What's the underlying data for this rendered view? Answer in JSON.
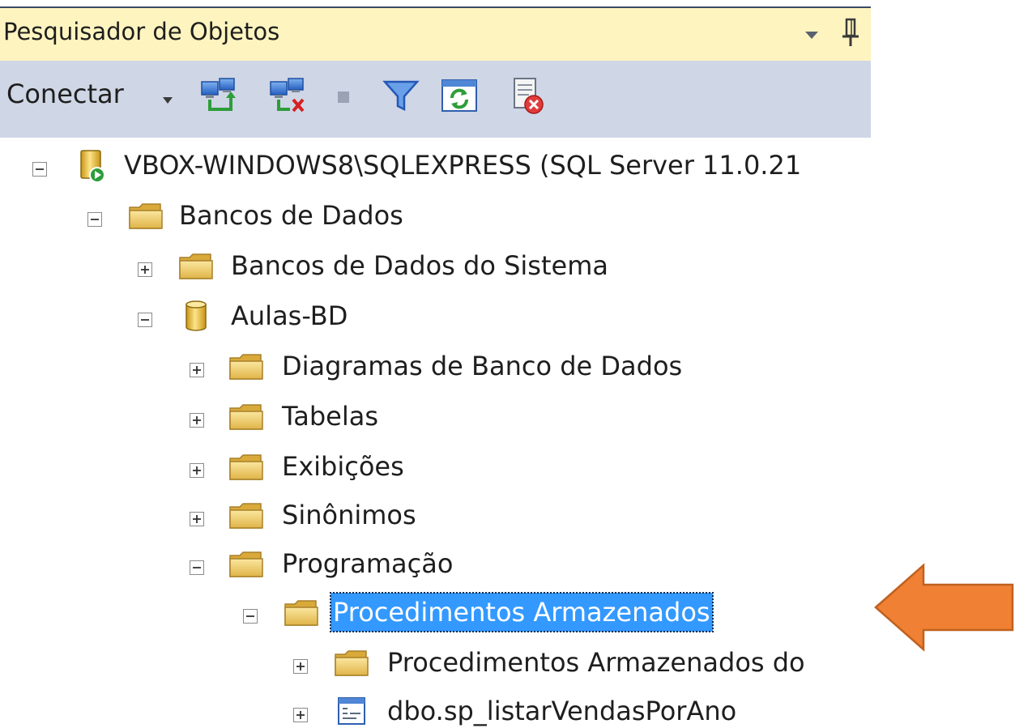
{
  "panel": {
    "title": "Pesquisador de Objetos"
  },
  "toolbar": {
    "connect_label": "Conectar",
    "icons": [
      "connect-object-explorer-icon",
      "disconnect-icon",
      "stop-icon",
      "filter-icon",
      "refresh-icon",
      "stop-activity-icon"
    ]
  },
  "tree": {
    "nodes": [
      {
        "label": "VBOX-WINDOWS8\\SQLEXPRESS (SQL Server 11.0.21",
        "expanded": true,
        "icon": "server-icon"
      },
      {
        "label": "Bancos de Dados",
        "expanded": true,
        "icon": "folder-icon"
      },
      {
        "label": "Bancos de Dados do Sistema",
        "expanded": false,
        "icon": "folder-icon"
      },
      {
        "label": "Aulas-BD",
        "expanded": true,
        "icon": "database-icon"
      },
      {
        "label": "Diagramas de Banco de Dados",
        "expanded": false,
        "icon": "folder-icon"
      },
      {
        "label": "Tabelas",
        "expanded": false,
        "icon": "folder-icon"
      },
      {
        "label": "Exibições",
        "expanded": false,
        "icon": "folder-icon"
      },
      {
        "label": "Sinônimos",
        "expanded": false,
        "icon": "folder-icon"
      },
      {
        "label": "Programação",
        "expanded": true,
        "icon": "folder-icon"
      },
      {
        "label": "Procedimentos Armazenados",
        "expanded": true,
        "icon": "folder-icon",
        "selected": true
      },
      {
        "label": "Procedimentos Armazenados do",
        "expanded": false,
        "icon": "folder-icon"
      },
      {
        "label": "dbo.sp_listarVendasPorAno",
        "expanded": false,
        "icon": "stored-procedure-icon"
      }
    ]
  },
  "colors": {
    "title_bg": "#fdf4bf",
    "toolbar_bg": "#cfd6e5",
    "selection": "#3399ff",
    "arrow": "#f08033"
  }
}
